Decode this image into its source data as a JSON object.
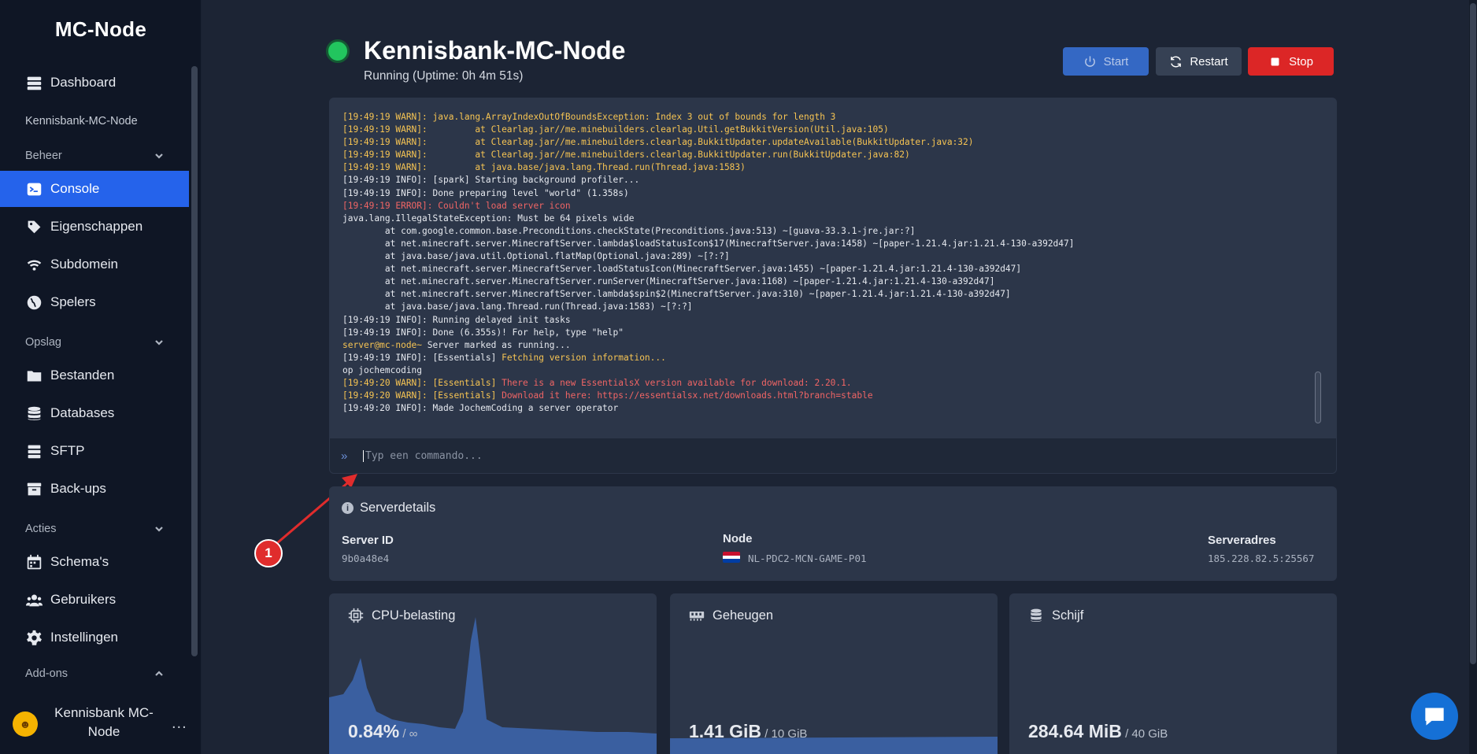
{
  "sidebar": {
    "brand": "MC-Node",
    "dashboard": "Dashboard",
    "server_name": "Kennisbank-MC-Node",
    "sections": {
      "beheer": "Beheer",
      "opslag": "Opslag",
      "acties": "Acties",
      "addons": "Add-ons"
    },
    "items": {
      "console": "Console",
      "eigenschappen": "Eigenschappen",
      "subdomein": "Subdomein",
      "spelers": "Spelers",
      "bestanden": "Bestanden",
      "databases": "Databases",
      "sftp": "SFTP",
      "backups": "Back-ups",
      "schemas": "Schema's",
      "gebruikers": "Gebruikers",
      "instellingen": "Instellingen"
    },
    "user": {
      "name_line1": "Kennisbank MC-",
      "name_line2": "Node",
      "more": "..."
    }
  },
  "header": {
    "title": "Kennisbank-MC-Node",
    "status": "Running (Uptime: 0h 4m 51s)",
    "start_label": "Start",
    "restart_label": "Restart",
    "stop_label": "Stop",
    "status_color": "#22c55e"
  },
  "console": {
    "lines": [
      [
        {
          "t": "[19:49:19 WARN]: java.lang.ArrayIndexOutOfBoundsException: Index 3 out of bounds for length 3",
          "c": "warn"
        }
      ],
      [
        {
          "t": "[19:49:19 WARN]:         at Clearlag.jar//me.minebuilders.clearlag.Util.getBukkitVersion(Util.java:105)",
          "c": "warn"
        }
      ],
      [
        {
          "t": "[19:49:19 WARN]:         at Clearlag.jar//me.minebuilders.clearlag.BukkitUpdater.updateAvailable(BukkitUpdater.java:32)",
          "c": "warn"
        }
      ],
      [
        {
          "t": "[19:49:19 WARN]:         at Clearlag.jar//me.minebuilders.clearlag.BukkitUpdater.run(BukkitUpdater.java:82)",
          "c": "warn"
        }
      ],
      [
        {
          "t": "[19:49:19 WARN]:         at java.base/java.lang.Thread.run(Thread.java:1583)",
          "c": "warn"
        }
      ],
      [
        {
          "t": "[19:49:19 INFO]: [spark] Starting background profiler...",
          "c": ""
        }
      ],
      [
        {
          "t": "[19:49:19 INFO]: Done preparing level \"world\" (1.358s)",
          "c": ""
        }
      ],
      [
        {
          "t": "[19:49:19 ERROR]: Couldn't load server icon",
          "c": "err"
        }
      ],
      [
        {
          "t": "java.lang.IllegalStateException: Must be 64 pixels wide",
          "c": ""
        }
      ],
      [
        {
          "t": "        at com.google.common.base.Preconditions.checkState(Preconditions.java:513) ~[guava-33.3.1-jre.jar:?]",
          "c": ""
        }
      ],
      [
        {
          "t": "        at net.minecraft.server.MinecraftServer.lambda$loadStatusIcon$17(MinecraftServer.java:1458) ~[paper-1.21.4.jar:1.21.4-130-a392d47]",
          "c": ""
        }
      ],
      [
        {
          "t": "        at java.base/java.util.Optional.flatMap(Optional.java:289) ~[?:?]",
          "c": ""
        }
      ],
      [
        {
          "t": "        at net.minecraft.server.MinecraftServer.loadStatusIcon(MinecraftServer.java:1455) ~[paper-1.21.4.jar:1.21.4-130-a392d47]",
          "c": ""
        }
      ],
      [
        {
          "t": "        at net.minecraft.server.MinecraftServer.runServer(MinecraftServer.java:1168) ~[paper-1.21.4.jar:1.21.4-130-a392d47]",
          "c": ""
        }
      ],
      [
        {
          "t": "        at net.minecraft.server.MinecraftServer.lambda$spin$2(MinecraftServer.java:310) ~[paper-1.21.4.jar:1.21.4-130-a392d47]",
          "c": ""
        }
      ],
      [
        {
          "t": "        at java.base/java.lang.Thread.run(Thread.java:1583) ~[?:?]",
          "c": ""
        }
      ],
      [
        {
          "t": "[19:49:19 INFO]: Running delayed init tasks",
          "c": ""
        }
      ],
      [
        {
          "t": "[19:49:19 INFO]: Done (6.355s)! For help, type \"help\"",
          "c": ""
        }
      ],
      [
        {
          "t": "server@mc-node~",
          "c": "warn"
        },
        {
          "t": " Server marked as running...",
          "c": ""
        }
      ],
      [
        {
          "t": "[19:49:19 INFO]: [Essentials] ",
          "c": ""
        },
        {
          "t": "Fetching version information...",
          "c": "warn"
        }
      ],
      [
        {
          "t": "op jochemcoding",
          "c": ""
        }
      ],
      [
        {
          "t": "[19:49:20 WARN]: [Essentials] ",
          "c": "warn"
        },
        {
          "t": "There is a new EssentialsX version available for download: 2.20.1.",
          "c": "err"
        }
      ],
      [
        {
          "t": "[19:49:20 WARN]: [Essentials] ",
          "c": "warn"
        },
        {
          "t": "Download it here: https://essentialsx.net/downloads.html?branch=stable",
          "c": "err"
        }
      ],
      [
        {
          "t": "[19:49:20 INFO]: Made JochemCoding a server operator",
          "c": ""
        }
      ]
    ],
    "prompt_icon": "double-chevron-right-icon",
    "prompt_glyph": "»",
    "input_placeholder": "Typ een commando..."
  },
  "annotation": {
    "badge": "1",
    "color": "#e02c2c"
  },
  "details": {
    "title": "Serverdetails",
    "info_glyph": "i",
    "server_id_label": "Server ID",
    "server_id": "9b0a48e4",
    "node_label": "Node",
    "node": "NL-PDC2-MCN-GAME-P01",
    "node_flag": "netherlands-flag",
    "address_label": "Serveradres",
    "address": "185.228.82.5:25567"
  },
  "stats": {
    "cpu": {
      "title": "CPU-belasting",
      "value": "0.84%",
      "suffix": " / ∞",
      "icon": "cpu-icon"
    },
    "memory": {
      "title": "Geheugen",
      "value": "1.41 GiB",
      "suffix": " / 10 GiB",
      "icon": "memory-icon"
    },
    "disk": {
      "title": "Schijf",
      "value": "284.64 MiB",
      "suffix": " / 40 GiB",
      "icon": "database-icon"
    }
  },
  "chart_colors": {
    "fill": "#3a5fa0",
    "card": "#2c3649"
  }
}
